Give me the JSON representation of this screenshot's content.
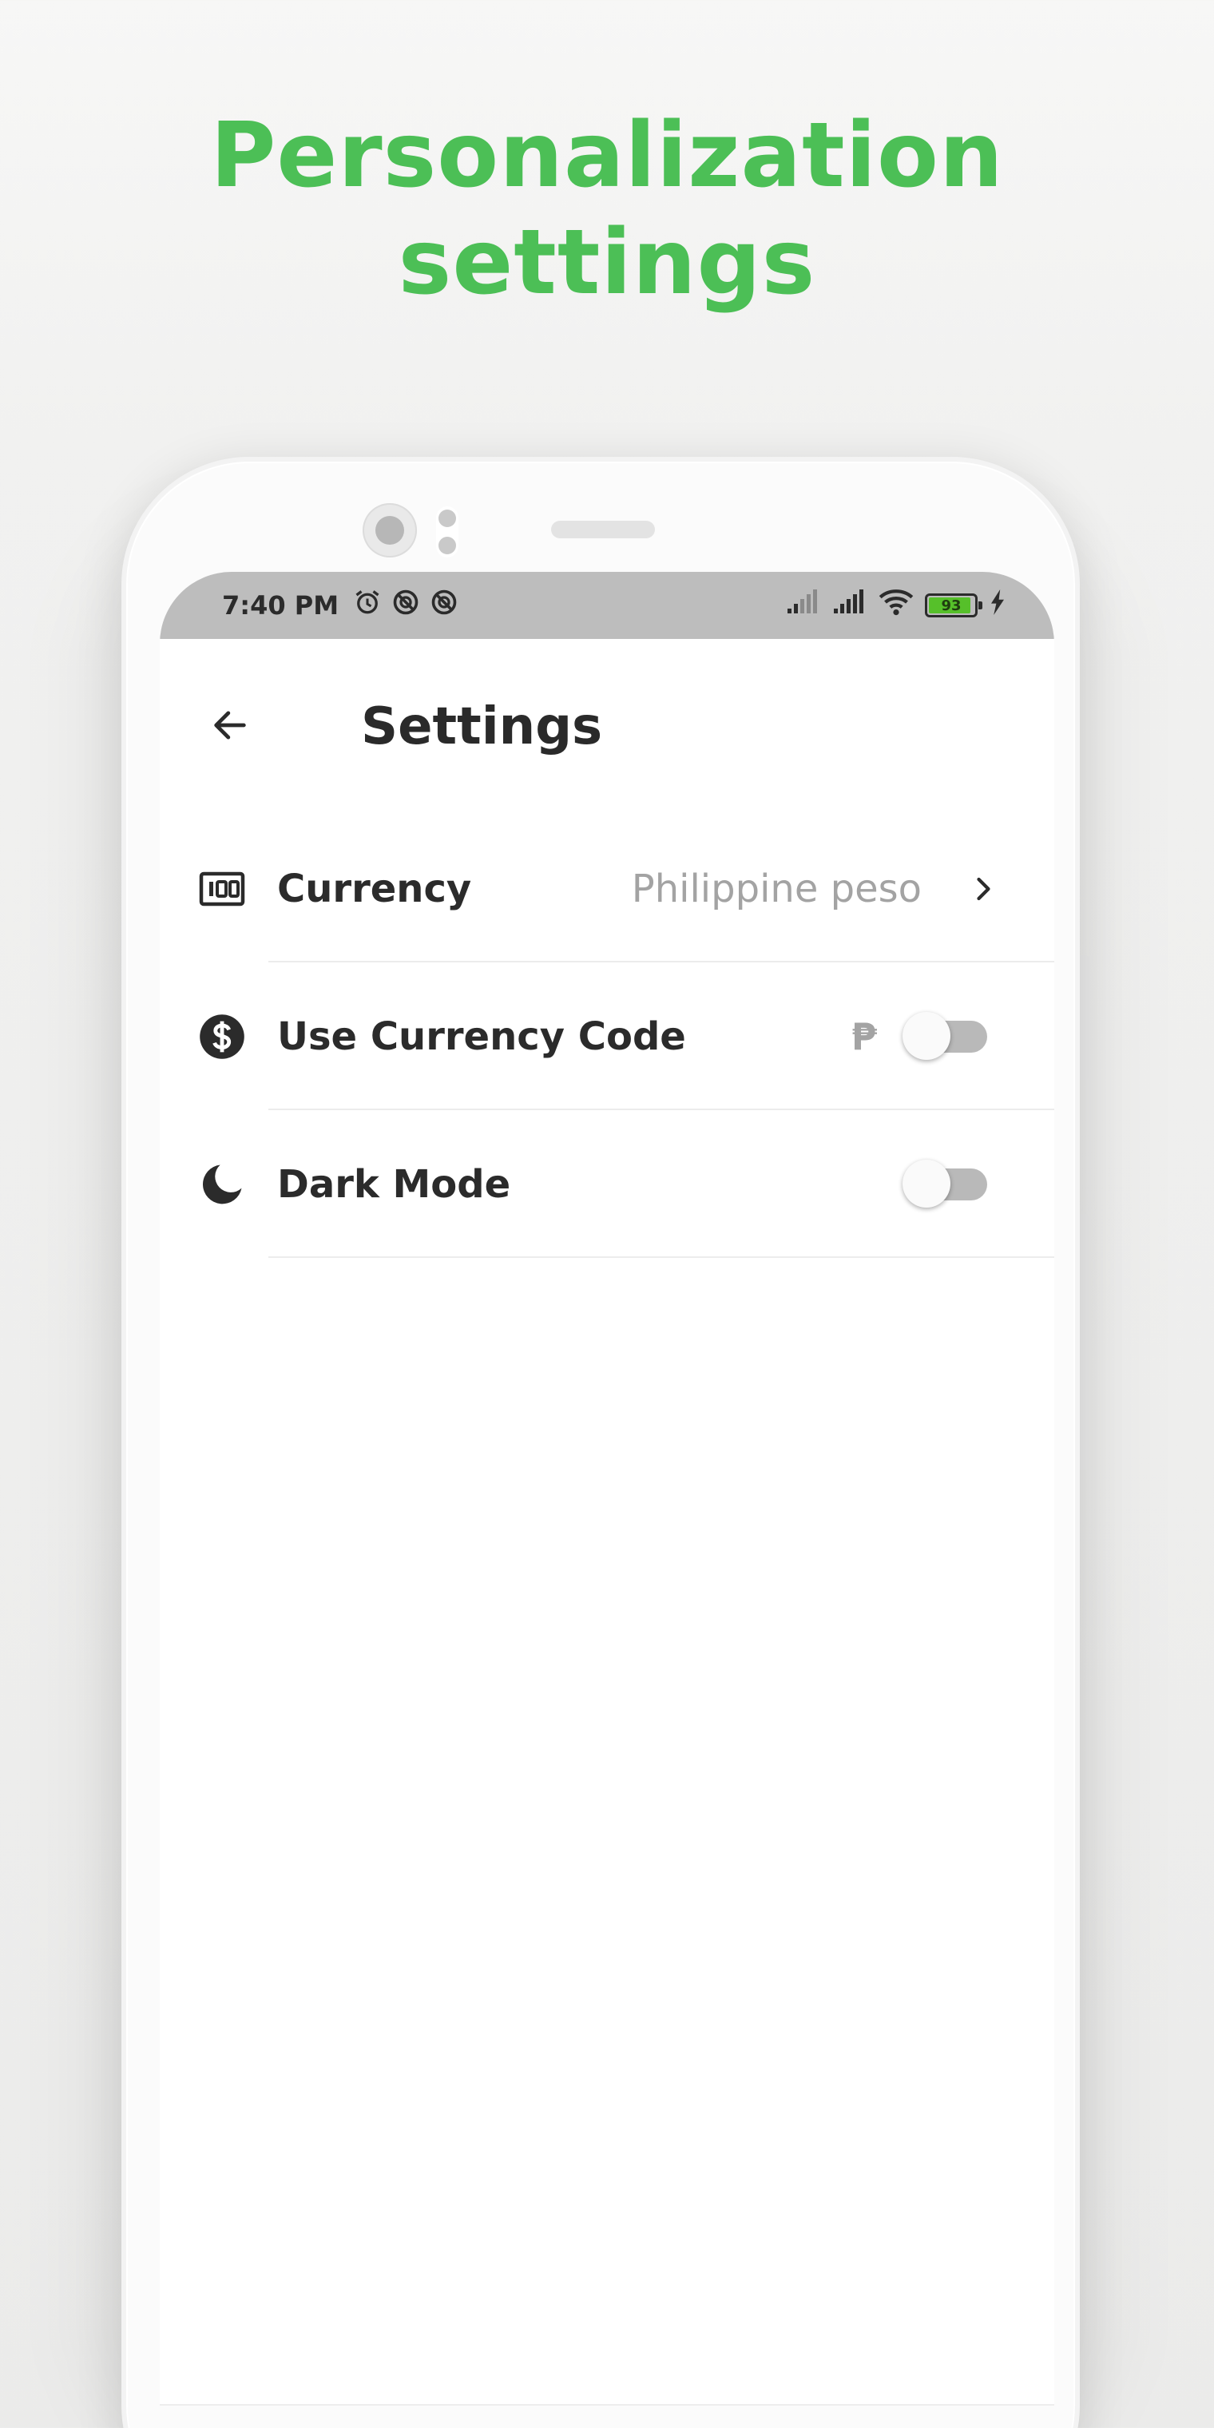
{
  "headline": {
    "line1": "Personalization",
    "line2": "settings"
  },
  "status_bar": {
    "time": "7:40 PM",
    "left_icons": [
      "alarm-icon",
      "sync-disabled-icon",
      "sync-disabled-icon"
    ],
    "right_icons": [
      "signal-icon",
      "signal-icon",
      "wifi-icon",
      "battery-icon",
      "charging-icon"
    ],
    "battery_level": "93"
  },
  "app_bar": {
    "title": "Settings",
    "back_icon": "arrow-back-icon"
  },
  "settings": {
    "currency": {
      "label": "Currency",
      "value": "Philippine peso",
      "icon": "banknote-icon"
    },
    "currency_code": {
      "label": "Use Currency Code",
      "symbol": "₱",
      "enabled": false,
      "icon": "dollar-circle-icon"
    },
    "dark_mode": {
      "label": "Dark Mode",
      "enabled": false,
      "icon": "moon-icon"
    }
  },
  "colors": {
    "accent": "#4cbf56",
    "text_primary": "#2b2b2b",
    "text_secondary": "#a3a3a3",
    "status_bar": "#bdbdbd",
    "toggle_off_track": "#b9b9b9"
  }
}
